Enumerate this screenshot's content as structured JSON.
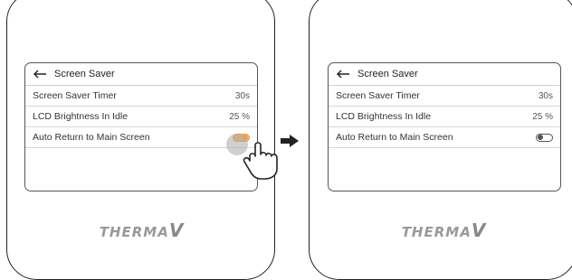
{
  "left_panel": {
    "header": {
      "title": "Screen Saver"
    },
    "rows": [
      {
        "label": "Screen Saver Timer",
        "value": "30s"
      },
      {
        "label": "LCD Brightness In Idle",
        "value": "25 %"
      },
      {
        "label": "Auto Return to Main Screen",
        "toggle": "on"
      }
    ],
    "logo": {
      "text": "THERMA",
      "mark": "V"
    }
  },
  "right_panel": {
    "header": {
      "title": "Screen Saver"
    },
    "rows": [
      {
        "label": "Screen Saver Timer",
        "value": "30s"
      },
      {
        "label": "LCD Brightness In Idle",
        "value": "25 %"
      },
      {
        "label": "Auto Return to Main Screen",
        "toggle": "off"
      }
    ],
    "logo": {
      "text": "THERMA",
      "mark": "V"
    }
  },
  "colors": {
    "toggle_on": "#f0a24a",
    "toggle_off": "#555555",
    "frame": "#222222"
  },
  "icons": [
    "back-arrow-icon",
    "tap-hand-icon",
    "right-arrow-icon"
  ]
}
